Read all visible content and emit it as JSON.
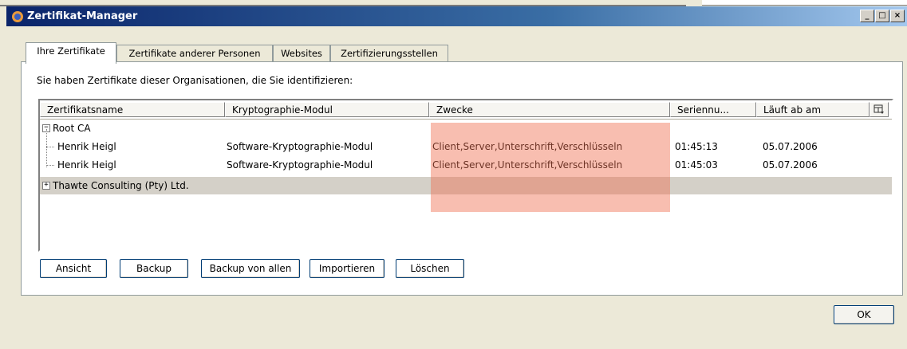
{
  "window": {
    "title": "Zertifikat-Manager",
    "btn_minimize": "_",
    "btn_maximize": "□",
    "btn_close": "×"
  },
  "tabs": [
    {
      "label": "Ihre Zertifikate",
      "active": true
    },
    {
      "label": "Zertifikate anderer Personen",
      "active": false
    },
    {
      "label": "Websites",
      "active": false
    },
    {
      "label": "Zertifizierungsstellen",
      "active": false
    }
  ],
  "info_text": "Sie haben Zertifikate dieser Organisationen, die Sie identifizieren:",
  "columns": [
    "Zertifikatsname",
    "Kryptographie-Modul",
    "Zwecke",
    "Seriennu...",
    "Läuft ab am"
  ],
  "tree": {
    "group1": {
      "label": "Root CA",
      "expander": "−"
    },
    "rows": [
      {
        "name": "Henrik Heigl",
        "module": "Software-Kryptographie-Modul",
        "purposes": "Client,Server,Unterschrift,Verschlüsseln",
        "serial": "01:45:13",
        "expires": "05.07.2006"
      },
      {
        "name": "Henrik Heigl",
        "module": "Software-Kryptographie-Modul",
        "purposes": "Client,Server,Unterschrift,Verschlüsseln",
        "serial": "01:45:03",
        "expires": "05.07.2006"
      }
    ],
    "group2": {
      "label": "Thawte Consulting (Pty) Ltd.",
      "expander": "+"
    }
  },
  "buttons": {
    "view": "Ansicht",
    "backup": "Backup",
    "backup_all": "Backup von allen",
    "import": "Importieren",
    "delete": "Löschen",
    "ok": "OK"
  },
  "colors": {
    "highlight": "#f06e50",
    "selected_row": "#d4d0c8",
    "title_start": "#0a246a",
    "title_end": "#a6caf0"
  }
}
